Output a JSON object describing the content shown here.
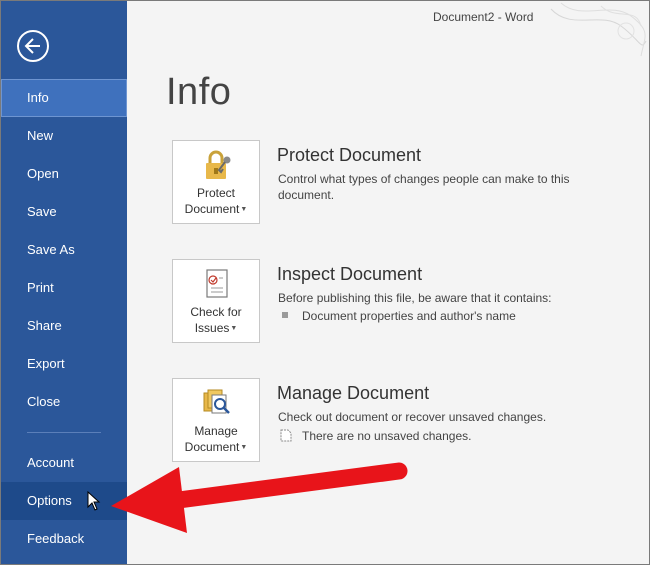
{
  "window": {
    "title": "Document2 - Word"
  },
  "sidebar": {
    "items": [
      {
        "label": "Info"
      },
      {
        "label": "New"
      },
      {
        "label": "Open"
      },
      {
        "label": "Save"
      },
      {
        "label": "Save As"
      },
      {
        "label": "Print"
      },
      {
        "label": "Share"
      },
      {
        "label": "Export"
      },
      {
        "label": "Close"
      }
    ],
    "bottom_items": [
      {
        "label": "Account"
      },
      {
        "label": "Options"
      },
      {
        "label": "Feedback"
      }
    ],
    "active": "Info",
    "hovered": "Options"
  },
  "main": {
    "title": "Info",
    "sections": [
      {
        "button_line1": "Protect",
        "button_line2": "Document",
        "title": "Protect Document",
        "desc": "Control what types of changes people can make to this document."
      },
      {
        "button_line1": "Check for",
        "button_line2": "Issues",
        "title": "Inspect Document",
        "desc": "Before publishing this file, be aware that it contains:",
        "bullet": "Document properties and author's name"
      },
      {
        "button_line1": "Manage",
        "button_line2": "Document",
        "title": "Manage Document",
        "desc": "Check out document or recover unsaved changes.",
        "bullet": "There are no unsaved changes."
      }
    ]
  },
  "colors": {
    "sidebar": "#2b579a",
    "sidebar_active": "#3f71bd",
    "arrow": "#e8141a"
  },
  "icons": [
    "back-arrow-icon",
    "lock-key-icon",
    "checklist-icon",
    "manage-document-icon",
    "mouse-pointer-icon"
  ]
}
